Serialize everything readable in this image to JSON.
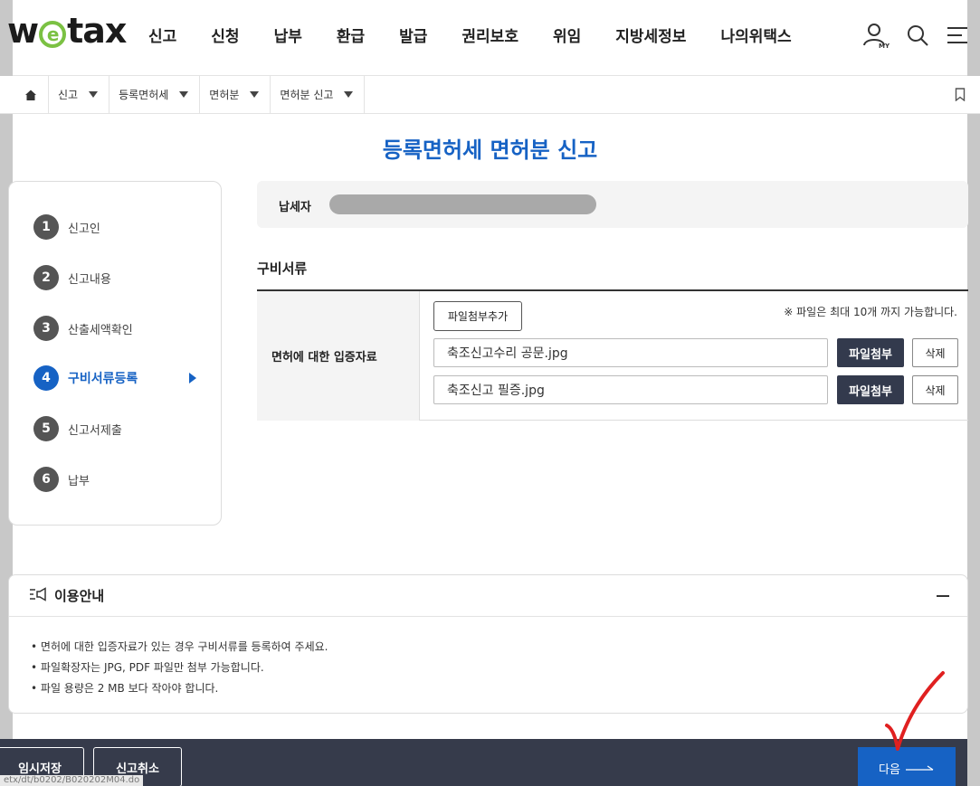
{
  "header": {
    "logo_pre": "w",
    "logo_e": "e",
    "logo_post": "tax",
    "menu": [
      "신고",
      "신청",
      "납부",
      "환급",
      "발급",
      "권리보호",
      "위임",
      "지방세정보",
      "나의위택스"
    ],
    "my_label": "MY"
  },
  "breadcrumb": [
    "신고",
    "등록면허세",
    "면허분",
    "면허분 신고"
  ],
  "page_title": "등록면허세 면허분 신고",
  "steps": [
    {
      "num": "1",
      "label": "신고인"
    },
    {
      "num": "2",
      "label": "신고내용"
    },
    {
      "num": "3",
      "label": "산출세액확인"
    },
    {
      "num": "4",
      "label": "구비서류등록",
      "active": true
    },
    {
      "num": "5",
      "label": "신고서제출"
    },
    {
      "num": "6",
      "label": "납부"
    }
  ],
  "taxpayer": {
    "label": "납세자"
  },
  "documents": {
    "section_title": "구비서류",
    "row_header": "면허에 대한 입증자료",
    "add_button": "파일첨부추가",
    "notice": "※ 파일은 최대 10개 까지 가능합니다.",
    "attach_label": "파일첨부",
    "delete_label": "삭제",
    "files": [
      "축조신고수리 공문.jpg",
      "축조신고 필증.jpg"
    ]
  },
  "guide": {
    "title": "이용안내",
    "items": [
      "면허에 대한 입증자료가 있는 경우 구비서류를 등록하여 주세요.",
      "파일확장자는 JPG, PDF 파일만 첨부 가능합니다.",
      "파일 용량은 2 MB 보다 작아야 합니다."
    ]
  },
  "bottom": {
    "save": "임시저장",
    "cancel": "신고취소",
    "next": "다음",
    "status_url": "etx/dt/b0202/B020202M04.do"
  },
  "colors": {
    "accent": "#1662c4",
    "dark_button": "#333a4d",
    "bottom_bar": "#363b4b",
    "logo_green": "#7bc143"
  }
}
